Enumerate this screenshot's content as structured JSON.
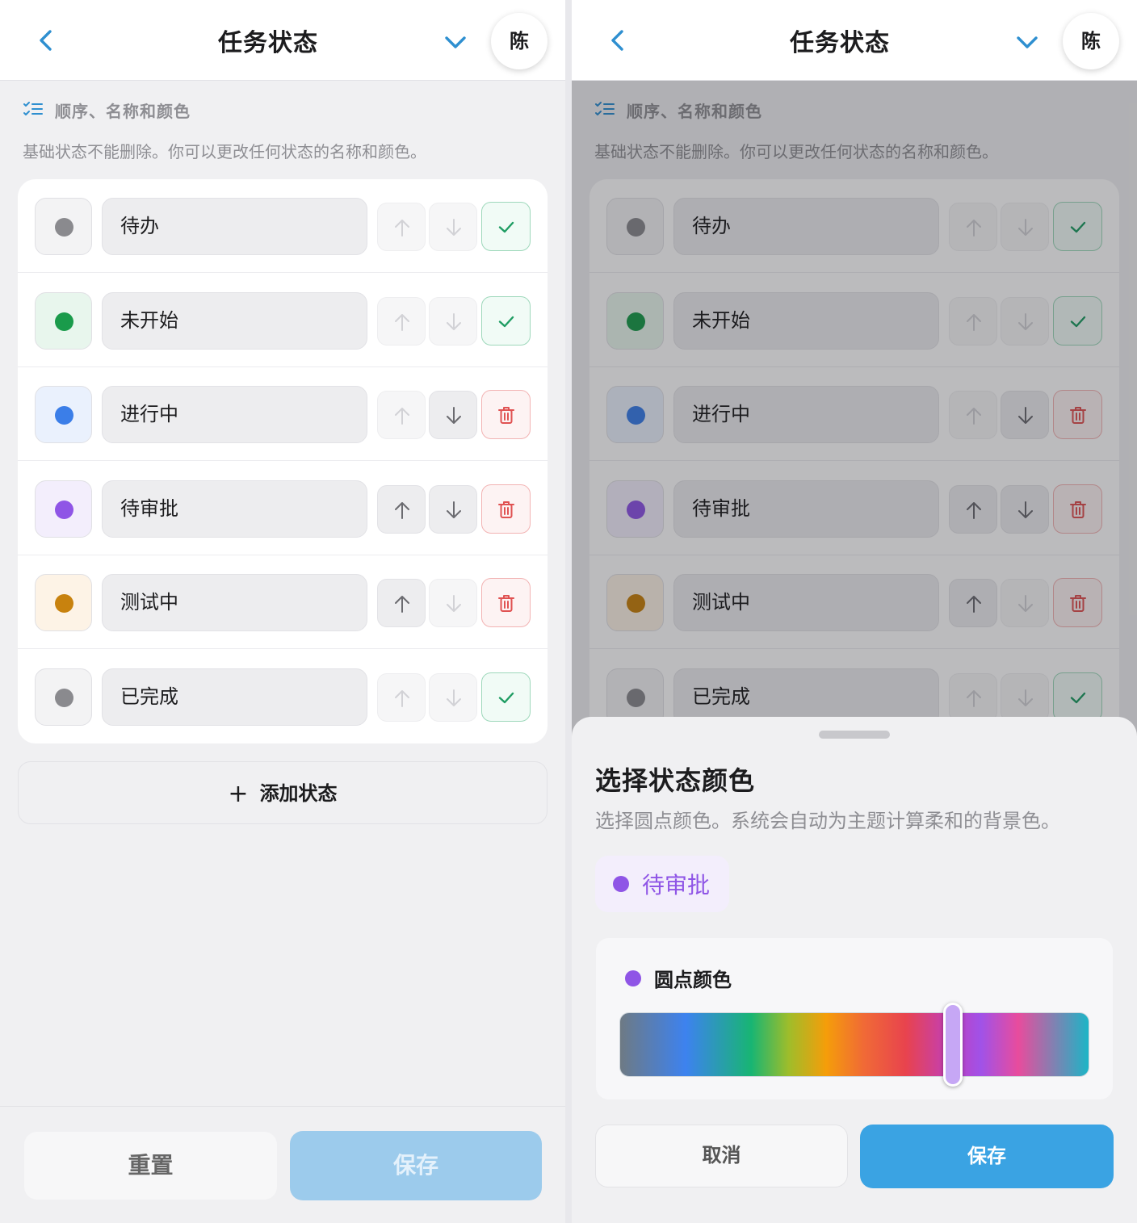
{
  "header": {
    "title": "任务状态",
    "avatar_text": "陈"
  },
  "section": {
    "title": "顺序、名称和颜色",
    "description": "基础状态不能删除。你可以更改任何状态的名称和颜色。"
  },
  "statuses": [
    {
      "name": "待办",
      "dot_color": "#8a8a8e",
      "swatch_bg": "#f3f3f4",
      "up_enabled": false,
      "down_enabled": false,
      "action": "confirm"
    },
    {
      "name": "未开始",
      "dot_color": "#1a9b4b",
      "swatch_bg": "#e8f6ed",
      "up_enabled": false,
      "down_enabled": false,
      "action": "confirm"
    },
    {
      "name": "进行中",
      "dot_color": "#3b7ee8",
      "swatch_bg": "#eaf1fd",
      "up_enabled": false,
      "down_enabled": true,
      "action": "delete"
    },
    {
      "name": "待审批",
      "dot_color": "#8f55e6",
      "swatch_bg": "#f3eefc",
      "up_enabled": true,
      "down_enabled": true,
      "action": "delete"
    },
    {
      "name": "测试中",
      "dot_color": "#c8820e",
      "swatch_bg": "#fdf3e6",
      "up_enabled": true,
      "down_enabled": false,
      "action": "delete"
    },
    {
      "name": "已完成",
      "dot_color": "#8a8a8e",
      "swatch_bg": "#f3f3f4",
      "up_enabled": false,
      "down_enabled": false,
      "action": "confirm"
    }
  ],
  "add_status_label": "添加状态",
  "footer": {
    "reset_label": "重置",
    "save_label": "保存"
  },
  "color_sheet": {
    "title": "选择状态颜色",
    "description": "选择圆点颜色。系统会自动为主题计算柔和的背景色。",
    "preview_name": "待审批",
    "preview_dot_color": "#8f55e6",
    "preview_bg": "#f3eefc",
    "dot_color_label": "圆点颜色",
    "hue_position": 0.71,
    "thumb_color": "#c6a7f5",
    "cancel_label": "取消",
    "save_label": "保存"
  },
  "colors": {
    "accent": "#2e8fd0",
    "primary_button": "#3aa3e3",
    "primary_button_disabled": "#9ccbec",
    "confirm": "#1f9d63",
    "delete": "#e05252"
  },
  "icons": {
    "back": "chevron-left-icon",
    "dropdown": "chevron-down-icon",
    "section": "checklist-icon",
    "move_up": "arrow-up-icon",
    "move_down": "arrow-down-icon",
    "confirm": "check-icon",
    "delete": "trash-icon",
    "add": "plus-icon"
  }
}
